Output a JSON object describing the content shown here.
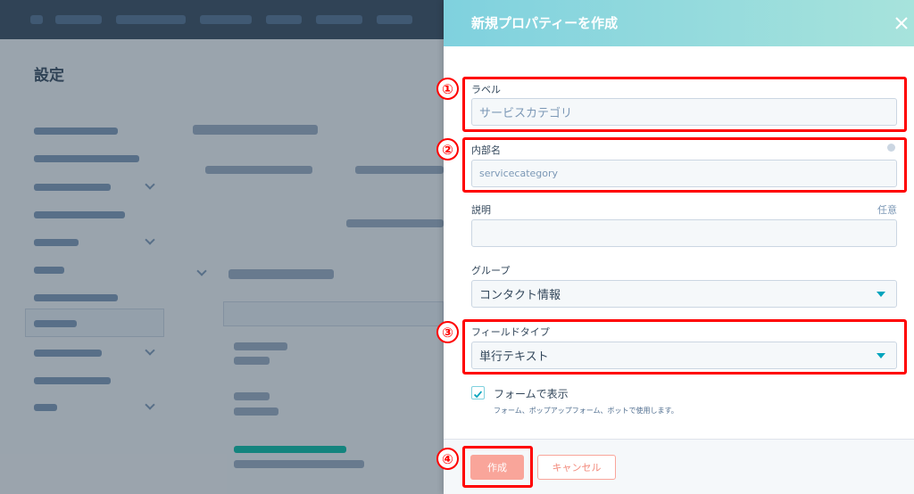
{
  "background": {
    "page_title": "設定"
  },
  "panel": {
    "title": "新規プロパティーを作成",
    "fields": {
      "label": {
        "label": "ラベル",
        "value": "サービスカテゴリ"
      },
      "internal_name": {
        "label": "内部名",
        "value": "servicecategory"
      },
      "description": {
        "label": "説明",
        "aux": "任意",
        "value": ""
      },
      "group": {
        "label": "グループ",
        "value": "コンタクト情報"
      },
      "field_type": {
        "label": "フィールドタイプ",
        "value": "単行テキスト"
      }
    },
    "show_in_form": {
      "label": "フォームで表示",
      "sub": "フォーム、ポップアップフォーム、ボットで使用します。",
      "checked": true
    },
    "buttons": {
      "create": "作成",
      "cancel": "キャンセル"
    }
  },
  "annotations": [
    "①",
    "②",
    "③",
    "④"
  ],
  "colors": {
    "header_gradient_start": "#7fd1de",
    "header_gradient_end": "#a7e3dc",
    "primary_button": "#f9a59a",
    "annotation_red": "#ff0000",
    "dropdown_caret": "#00a4bd"
  }
}
